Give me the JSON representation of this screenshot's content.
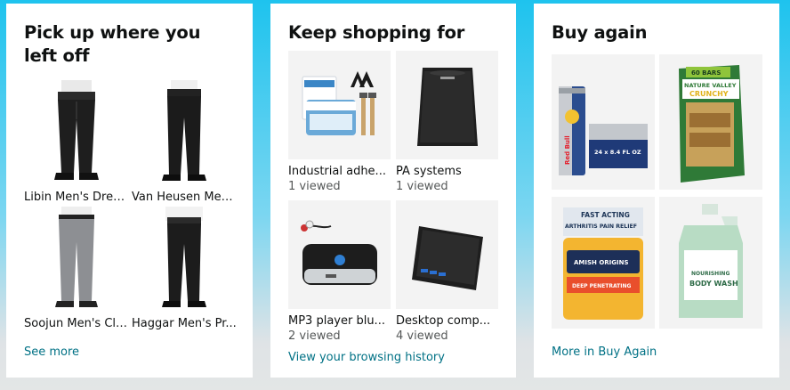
{
  "cards": [
    {
      "title": "Pick up where you left off",
      "items": [
        {
          "name": "Libin Men's Dress..."
        },
        {
          "name": "Van Heusen Men..."
        },
        {
          "name": "Soojun Men's Cla..."
        },
        {
          "name": "Haggar Men's Pr..."
        }
      ],
      "link": "See more"
    },
    {
      "title": "Keep shopping for",
      "items": [
        {
          "name": "Industrial adhe...",
          "count": "1 viewed"
        },
        {
          "name": "PA systems",
          "count": "1 viewed"
        },
        {
          "name": "MP3 player blu...",
          "count": "2 viewed"
        },
        {
          "name": "Desktop comp...",
          "count": "4 viewed"
        }
      ],
      "link": "View your browsing history"
    },
    {
      "title": "Buy again",
      "items": [
        {
          "image": "energy-drink-pack"
        },
        {
          "image": "granola-bars-box"
        },
        {
          "image": "pain-relief-cream-jar"
        },
        {
          "image": "body-wash-gallon"
        }
      ],
      "link": "More in Buy Again",
      "product_text": {
        "redbull_brand": "Red Bull",
        "redbull_pack": "24 x 8.4 FL OZ",
        "nv_count": "60 BARS",
        "nv_brand": "NATURE VALLEY",
        "nv_flavor": "CRUNCHY",
        "amish_top1": "FAST ACTING",
        "amish_top2": "ARTHRITIS PAIN RELIEF",
        "amish_brand": "AMISH ORIGINS",
        "amish_desc": "DEEP PENETRATING",
        "bodywash_line1": "NOURISHING",
        "bodywash_line2": "BODY WASH"
      }
    }
  ],
  "colors": {
    "link": "#007185",
    "title": "#0f1111",
    "muted": "#565959",
    "page_top": "#1ec3ee",
    "page_bottom": "#e3e6e6"
  }
}
